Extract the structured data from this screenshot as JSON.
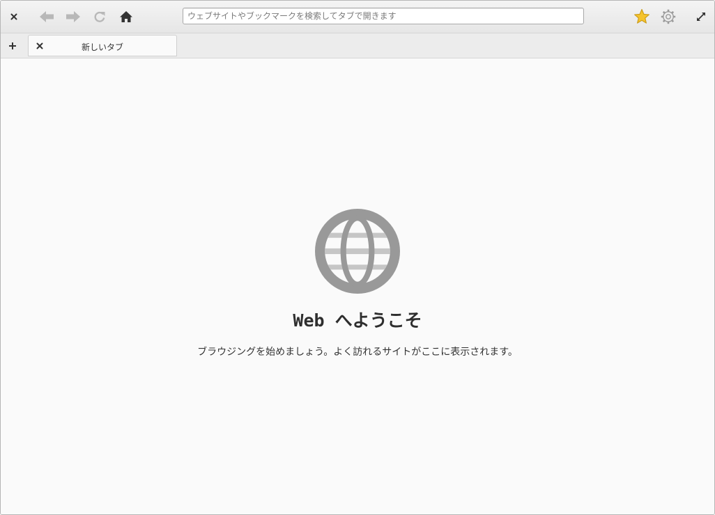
{
  "toolbar": {
    "close_icon": "close-icon",
    "back_icon": "back-arrow-icon",
    "forward_icon": "forward-arrow-icon",
    "reload_icon": "reload-icon",
    "home_icon": "home-icon",
    "search": {
      "placeholder": "ウェブサイトやブックマークを検索してタブで開きます",
      "value": ""
    },
    "bookmark_icon": "star-icon",
    "settings_icon": "gear-icon",
    "fullscreen_icon": "expand-icon"
  },
  "tabs": {
    "new_tab_icon": "plus-icon",
    "items": [
      {
        "title": "新しいタブ",
        "close_icon": "close-icon",
        "active": true
      }
    ]
  },
  "welcome": {
    "icon": "globe-icon",
    "title": "Web へようこそ",
    "message": "ブラウジングを始めましょう。よく訪れるサイトがここに表示されます。"
  },
  "colors": {
    "star": "#f5c32c",
    "globe": "#999999",
    "disabled_icon": "#b8b8b8",
    "active_icon": "#333333"
  }
}
